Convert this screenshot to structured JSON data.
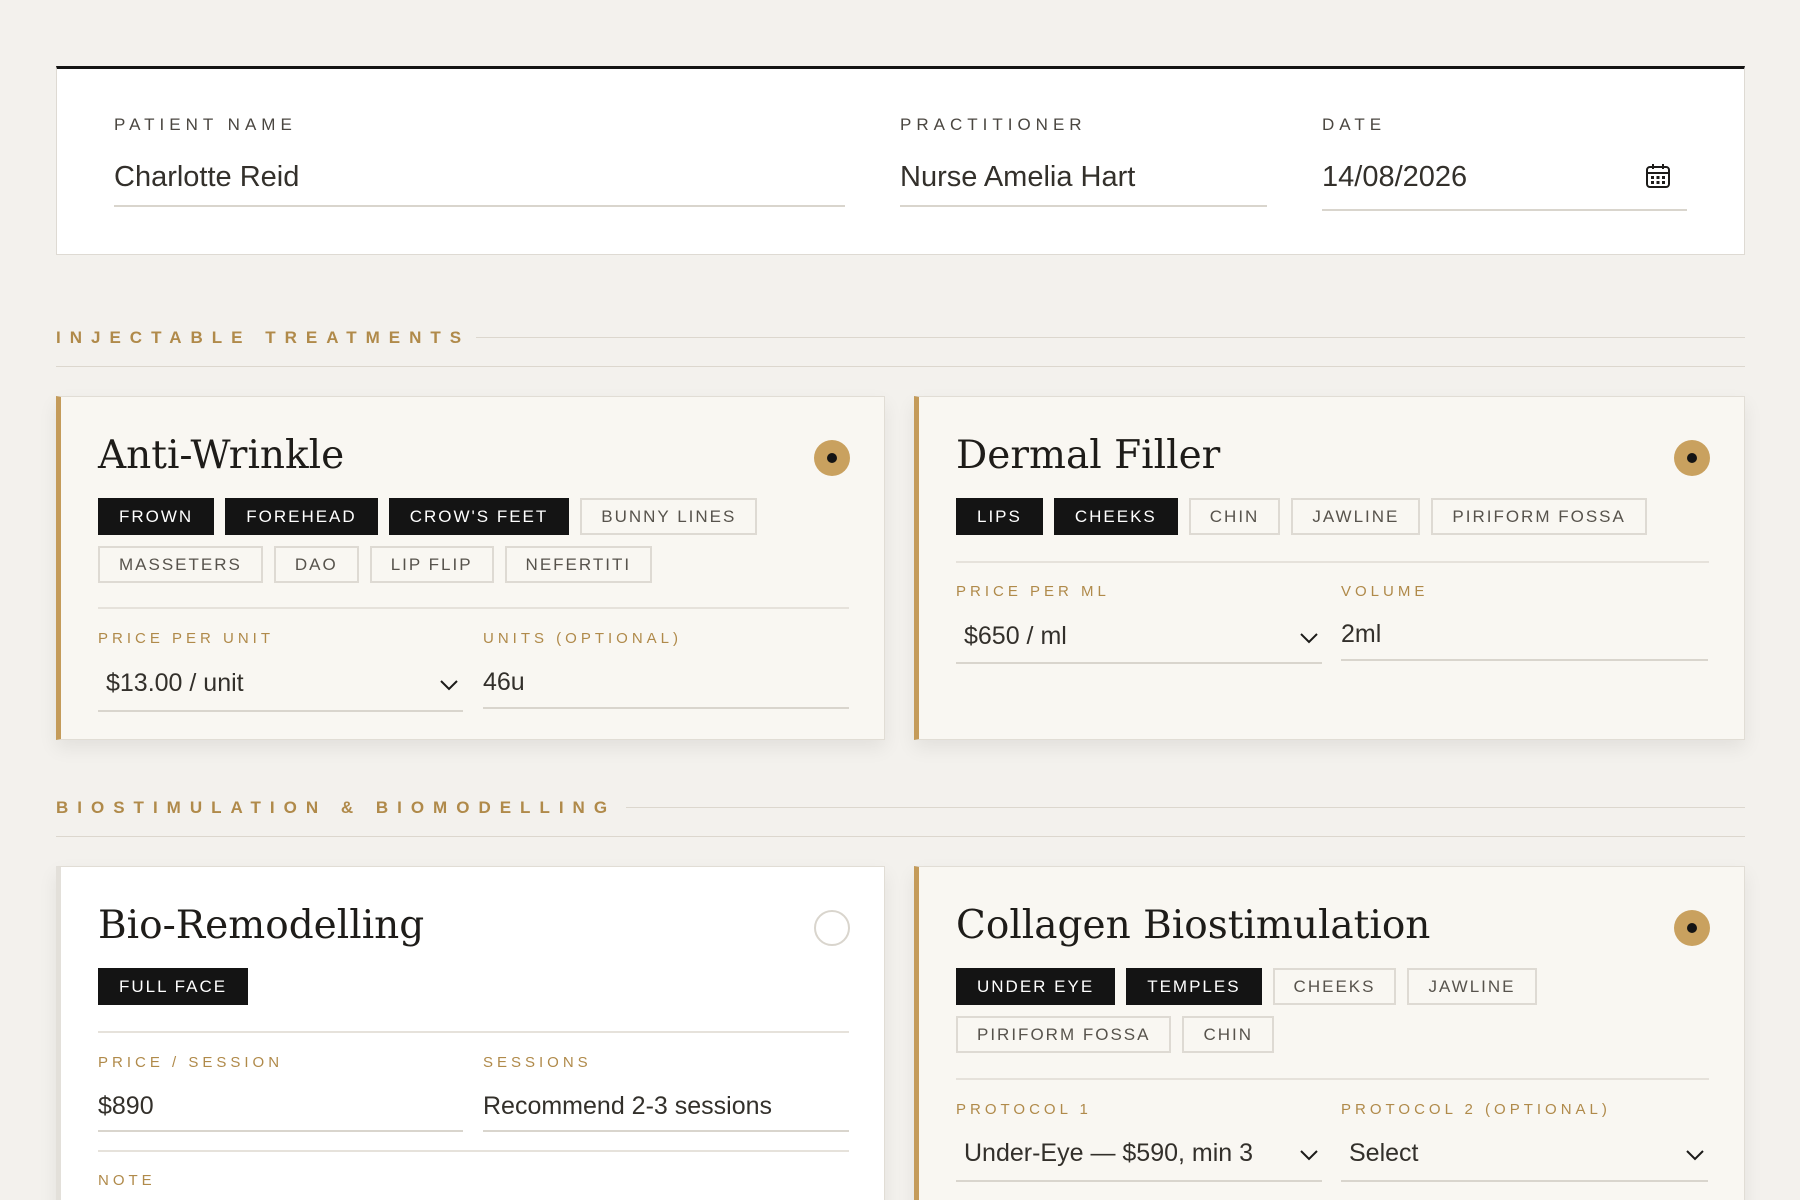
{
  "header": {
    "patient_label": "PATIENT NAME",
    "patient_value": "Charlotte Reid",
    "practitioner_label": "PRACTITIONER",
    "practitioner_value": "Nurse Amelia Hart",
    "date_label": "DATE",
    "date_value": "14/08/2026",
    "date_icon": "calendar-icon"
  },
  "sections": {
    "injectables": "INJECTABLE TREATMENTS",
    "biostim": "BIOSTIMULATION & BIOMODELLING"
  },
  "colors": {
    "accent": "#c49b5a",
    "section_text": "#b08a4a",
    "tag_selected_bg": "#141414",
    "background": "#f3f1ed"
  },
  "anti_wrinkle": {
    "title": "Anti-Wrinkle",
    "selected": true,
    "tags": [
      {
        "label": "FROWN",
        "selected": true
      },
      {
        "label": "FOREHEAD",
        "selected": true
      },
      {
        "label": "CROW'S FEET",
        "selected": true
      },
      {
        "label": "BUNNY LINES",
        "selected": false
      },
      {
        "label": "MASSETERS",
        "selected": false
      },
      {
        "label": "DAO",
        "selected": false
      },
      {
        "label": "LIP FLIP",
        "selected": false
      },
      {
        "label": "NEFERTITI",
        "selected": false
      }
    ],
    "price_label": "PRICE PER UNIT",
    "price_value": "$13.00 / unit",
    "units_label": "UNITS (OPTIONAL)",
    "units_value": "46u"
  },
  "dermal_filler": {
    "title": "Dermal Filler",
    "selected": true,
    "tags": [
      {
        "label": "LIPS",
        "selected": true
      },
      {
        "label": "CHEEKS",
        "selected": true
      },
      {
        "label": "CHIN",
        "selected": false
      },
      {
        "label": "JAWLINE",
        "selected": false
      },
      {
        "label": "PIRIFORM FOSSA",
        "selected": false
      }
    ],
    "price_label": "PRICE PER ML",
    "price_value": "$650 / ml",
    "volume_label": "VOLUME",
    "volume_value": "2ml"
  },
  "bio_remodelling": {
    "title": "Bio-Remodelling",
    "selected": false,
    "tags": [
      {
        "label": "FULL FACE",
        "selected": true
      }
    ],
    "price_label": "PRICE / SESSION",
    "price_value": "$890",
    "sessions_label": "SESSIONS",
    "sessions_value": "Recommend 2-3 sessions",
    "note_label": "NOTE"
  },
  "collagen": {
    "title": "Collagen Biostimulation",
    "selected": true,
    "tags": [
      {
        "label": "UNDER EYE",
        "selected": true
      },
      {
        "label": "TEMPLES",
        "selected": true
      },
      {
        "label": "CHEEKS",
        "selected": false
      },
      {
        "label": "JAWLINE",
        "selected": false
      },
      {
        "label": "PIRIFORM FOSSA",
        "selected": false
      },
      {
        "label": "CHIN",
        "selected": false
      }
    ],
    "protocol1_label": "PROTOCOL 1",
    "protocol1_value": "Under-Eye — $590, min 3",
    "protocol2_label": "PROTOCOL 2 (OPTIONAL)",
    "protocol2_value": "Select"
  }
}
